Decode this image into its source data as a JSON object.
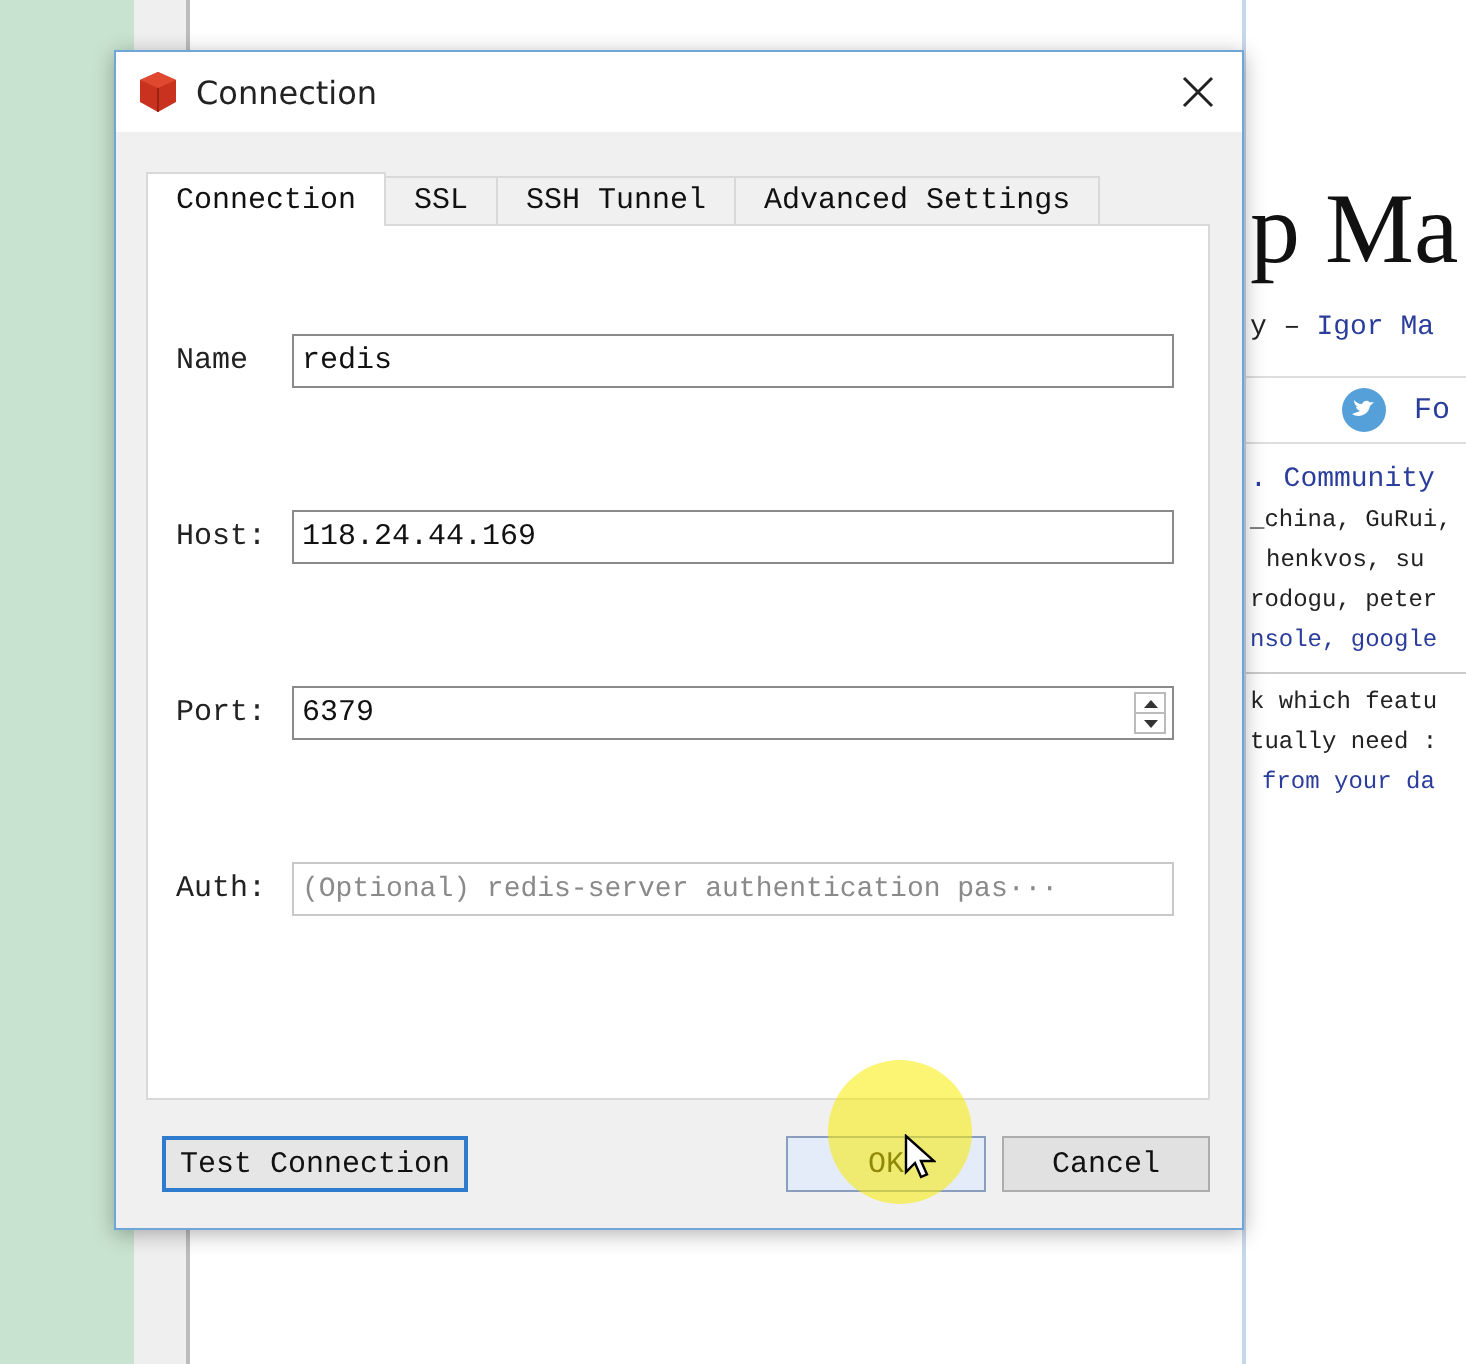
{
  "window": {
    "title": "Connection"
  },
  "tabs": [
    {
      "label": "Connection",
      "selected": true
    },
    {
      "label": "SSL",
      "selected": false
    },
    {
      "label": "SSH Tunnel",
      "selected": false
    },
    {
      "label": "Advanced Settings",
      "selected": false
    }
  ],
  "fields": [
    {
      "kind": "text",
      "label": "Name",
      "value": "redis"
    },
    {
      "kind": "text",
      "label": "Host:",
      "value": "118.24.44.169"
    },
    {
      "kind": "spin",
      "label": "Port:",
      "value": "6379"
    },
    {
      "kind": "text",
      "label": "Auth:",
      "placeholder": "(Optional) redis-server authentication pas···"
    }
  ],
  "buttons": [
    {
      "label": "Test Connection",
      "focused": true,
      "hovered": false
    },
    {
      "label": "OK",
      "focused": false,
      "hovered": true
    },
    {
      "label": "Cancel",
      "focused": false,
      "hovered": false
    }
  ],
  "background_page": {
    "heading": "p Ma",
    "byline_prefix": "y –",
    "byline_link": "Igor Ma",
    "follow": "Fo",
    "lines": [
      {
        "kind": "link",
        "text": ". Community"
      },
      {
        "kind": "plain",
        "text": "_china, GuRui,"
      },
      {
        "kind": "plain",
        "text": "henkvos, su"
      },
      {
        "kind": "plain",
        "text": "rodogu, peter"
      },
      {
        "kind": "link",
        "text": "nsole, google"
      },
      {
        "kind": "plain",
        "text": "k which featu"
      },
      {
        "kind": "plain",
        "text": "tually need :"
      },
      {
        "kind": "link",
        "text": "from your da"
      }
    ]
  }
}
